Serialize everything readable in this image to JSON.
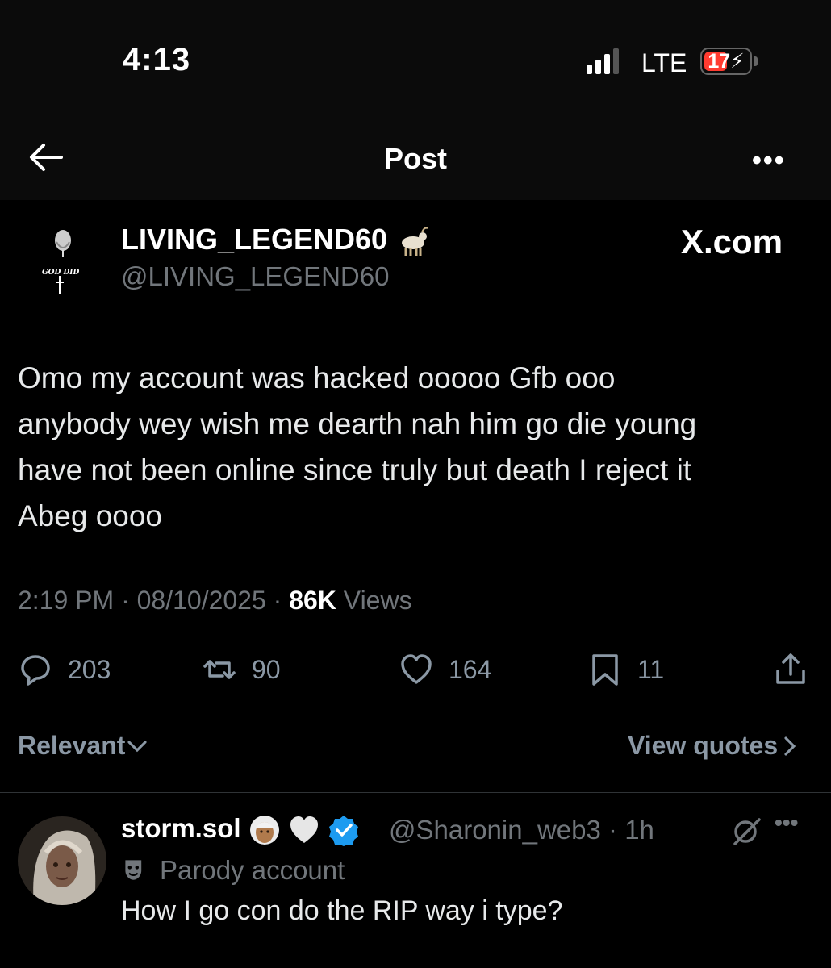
{
  "status_bar": {
    "time": "4:13",
    "network": "LTE",
    "battery_level": "17",
    "battery_color": "#ff3b30"
  },
  "header": {
    "title": "Post",
    "back_icon": "arrow-left-icon",
    "more_icon": "more-horizontal-icon"
  },
  "post": {
    "author_name": "LIVING_LEGEND60",
    "author_emoji": "goat",
    "author_handle": "@LIVING_LEGEND60",
    "source_label": "X.com",
    "text_lines": [
      "Omo my account was hacked ooooo Gfb ooo",
      "anybody wey wish me dearth nah him go die young",
      "have not been online since truly but death I reject it",
      "Abeg oooo"
    ],
    "time": "2:19 PM",
    "date": "08/10/2025",
    "views_count": "86K",
    "views_label": "Views",
    "dot": "·",
    "replies": "203",
    "reposts": "90",
    "likes": "164",
    "bookmarks": "11"
  },
  "sort": {
    "relevant_label": "Relevant",
    "view_quotes_label": "View quotes"
  },
  "reply": {
    "name": "storm.sol",
    "handle": "@Sharonin_web3",
    "time": "1h",
    "parody_label": "Parody account",
    "text": "How I go con do the RIP way i type?",
    "verified_color": "#1d9bf0"
  }
}
